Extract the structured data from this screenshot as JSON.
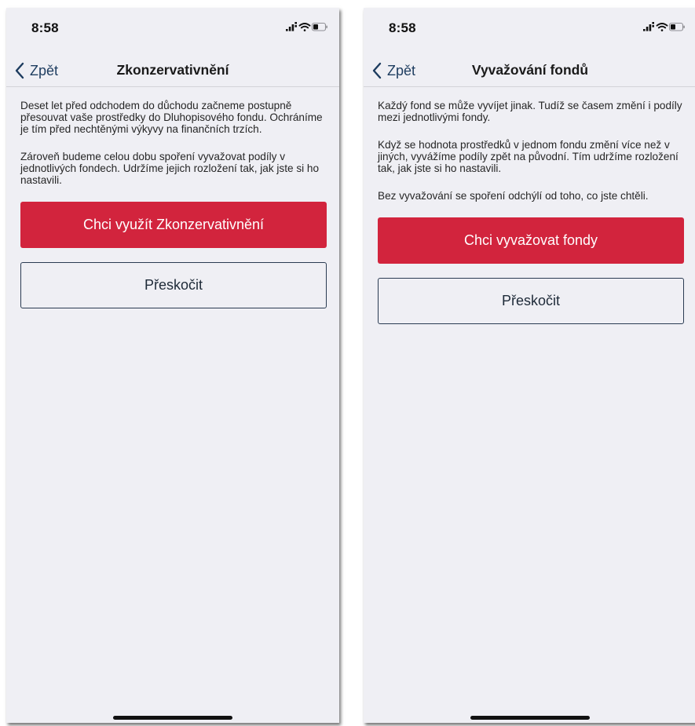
{
  "screens": [
    {
      "status_bar": {
        "time": "8:58"
      },
      "nav": {
        "back_label": "Zpět",
        "title": "Zkonzervativnění"
      },
      "paragraphs": [
        "Deset let před odchodem do důchodu začneme postupně přesouvat vaše prostředky do Dluhopisového fondu. Ochráníme je tím před nechtěnými výkyvy na finančních trzích.",
        "Zároveň budeme celou dobu spoření vyvažovat podíly v jednotlivých fondech. Udržíme jejich rozložení tak, jak jste si ho nastavili."
      ],
      "primary_button": "Chci využít Zkonzervativnění",
      "secondary_button": "Přeskočit"
    },
    {
      "status_bar": {
        "time": "8:58"
      },
      "nav": {
        "back_label": "Zpět",
        "title": "Vyvažování fondů"
      },
      "paragraphs": [
        "Každý fond se může vyvíjet jinak. Tudíž se časem změní i podíly mezi jednotlivými fondy.",
        "Když se hodnota prostředků v jednom fondu změní více než v jiných, vyvážíme podíly zpět na původní. Tím udržíme rozložení tak, jak jste si ho nastavili.",
        "Bez vyvažování se spoření odchýlí od toho, co jste chtěli."
      ],
      "primary_button": "Chci vyvažovat fondy",
      "secondary_button": "Přeskočit"
    }
  ],
  "icons": {
    "signal": "signal-icon",
    "wifi": "wifi-icon",
    "battery": "battery-icon",
    "back": "chevron-left-icon"
  },
  "colors": {
    "primary": "#d2243d",
    "nav_accent": "#1d3c5f",
    "background": "#efeff4",
    "secondary_border": "#2a3b52"
  }
}
